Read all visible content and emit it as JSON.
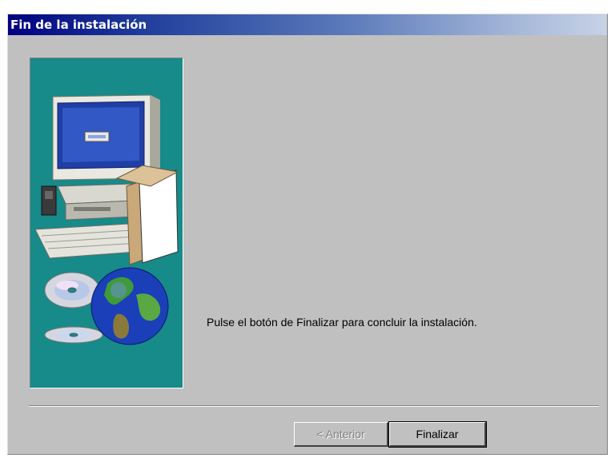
{
  "window": {
    "title": "Fin de la instalación"
  },
  "main": {
    "message": "Pulse el botón de Finalizar para concluir la instalación."
  },
  "buttons": {
    "back_label": "< Anterior",
    "back_enabled": false,
    "finish_label": "Finalizar"
  },
  "illustration": {
    "icons": [
      "computer-icon",
      "box-icon",
      "cd-icon",
      "globe-icon"
    ],
    "background_color": "#178a8a"
  },
  "colors": {
    "title_bar_start": "#000080",
    "title_bar_end": "#c7d2e6",
    "window_face": "#c0c0c0"
  }
}
